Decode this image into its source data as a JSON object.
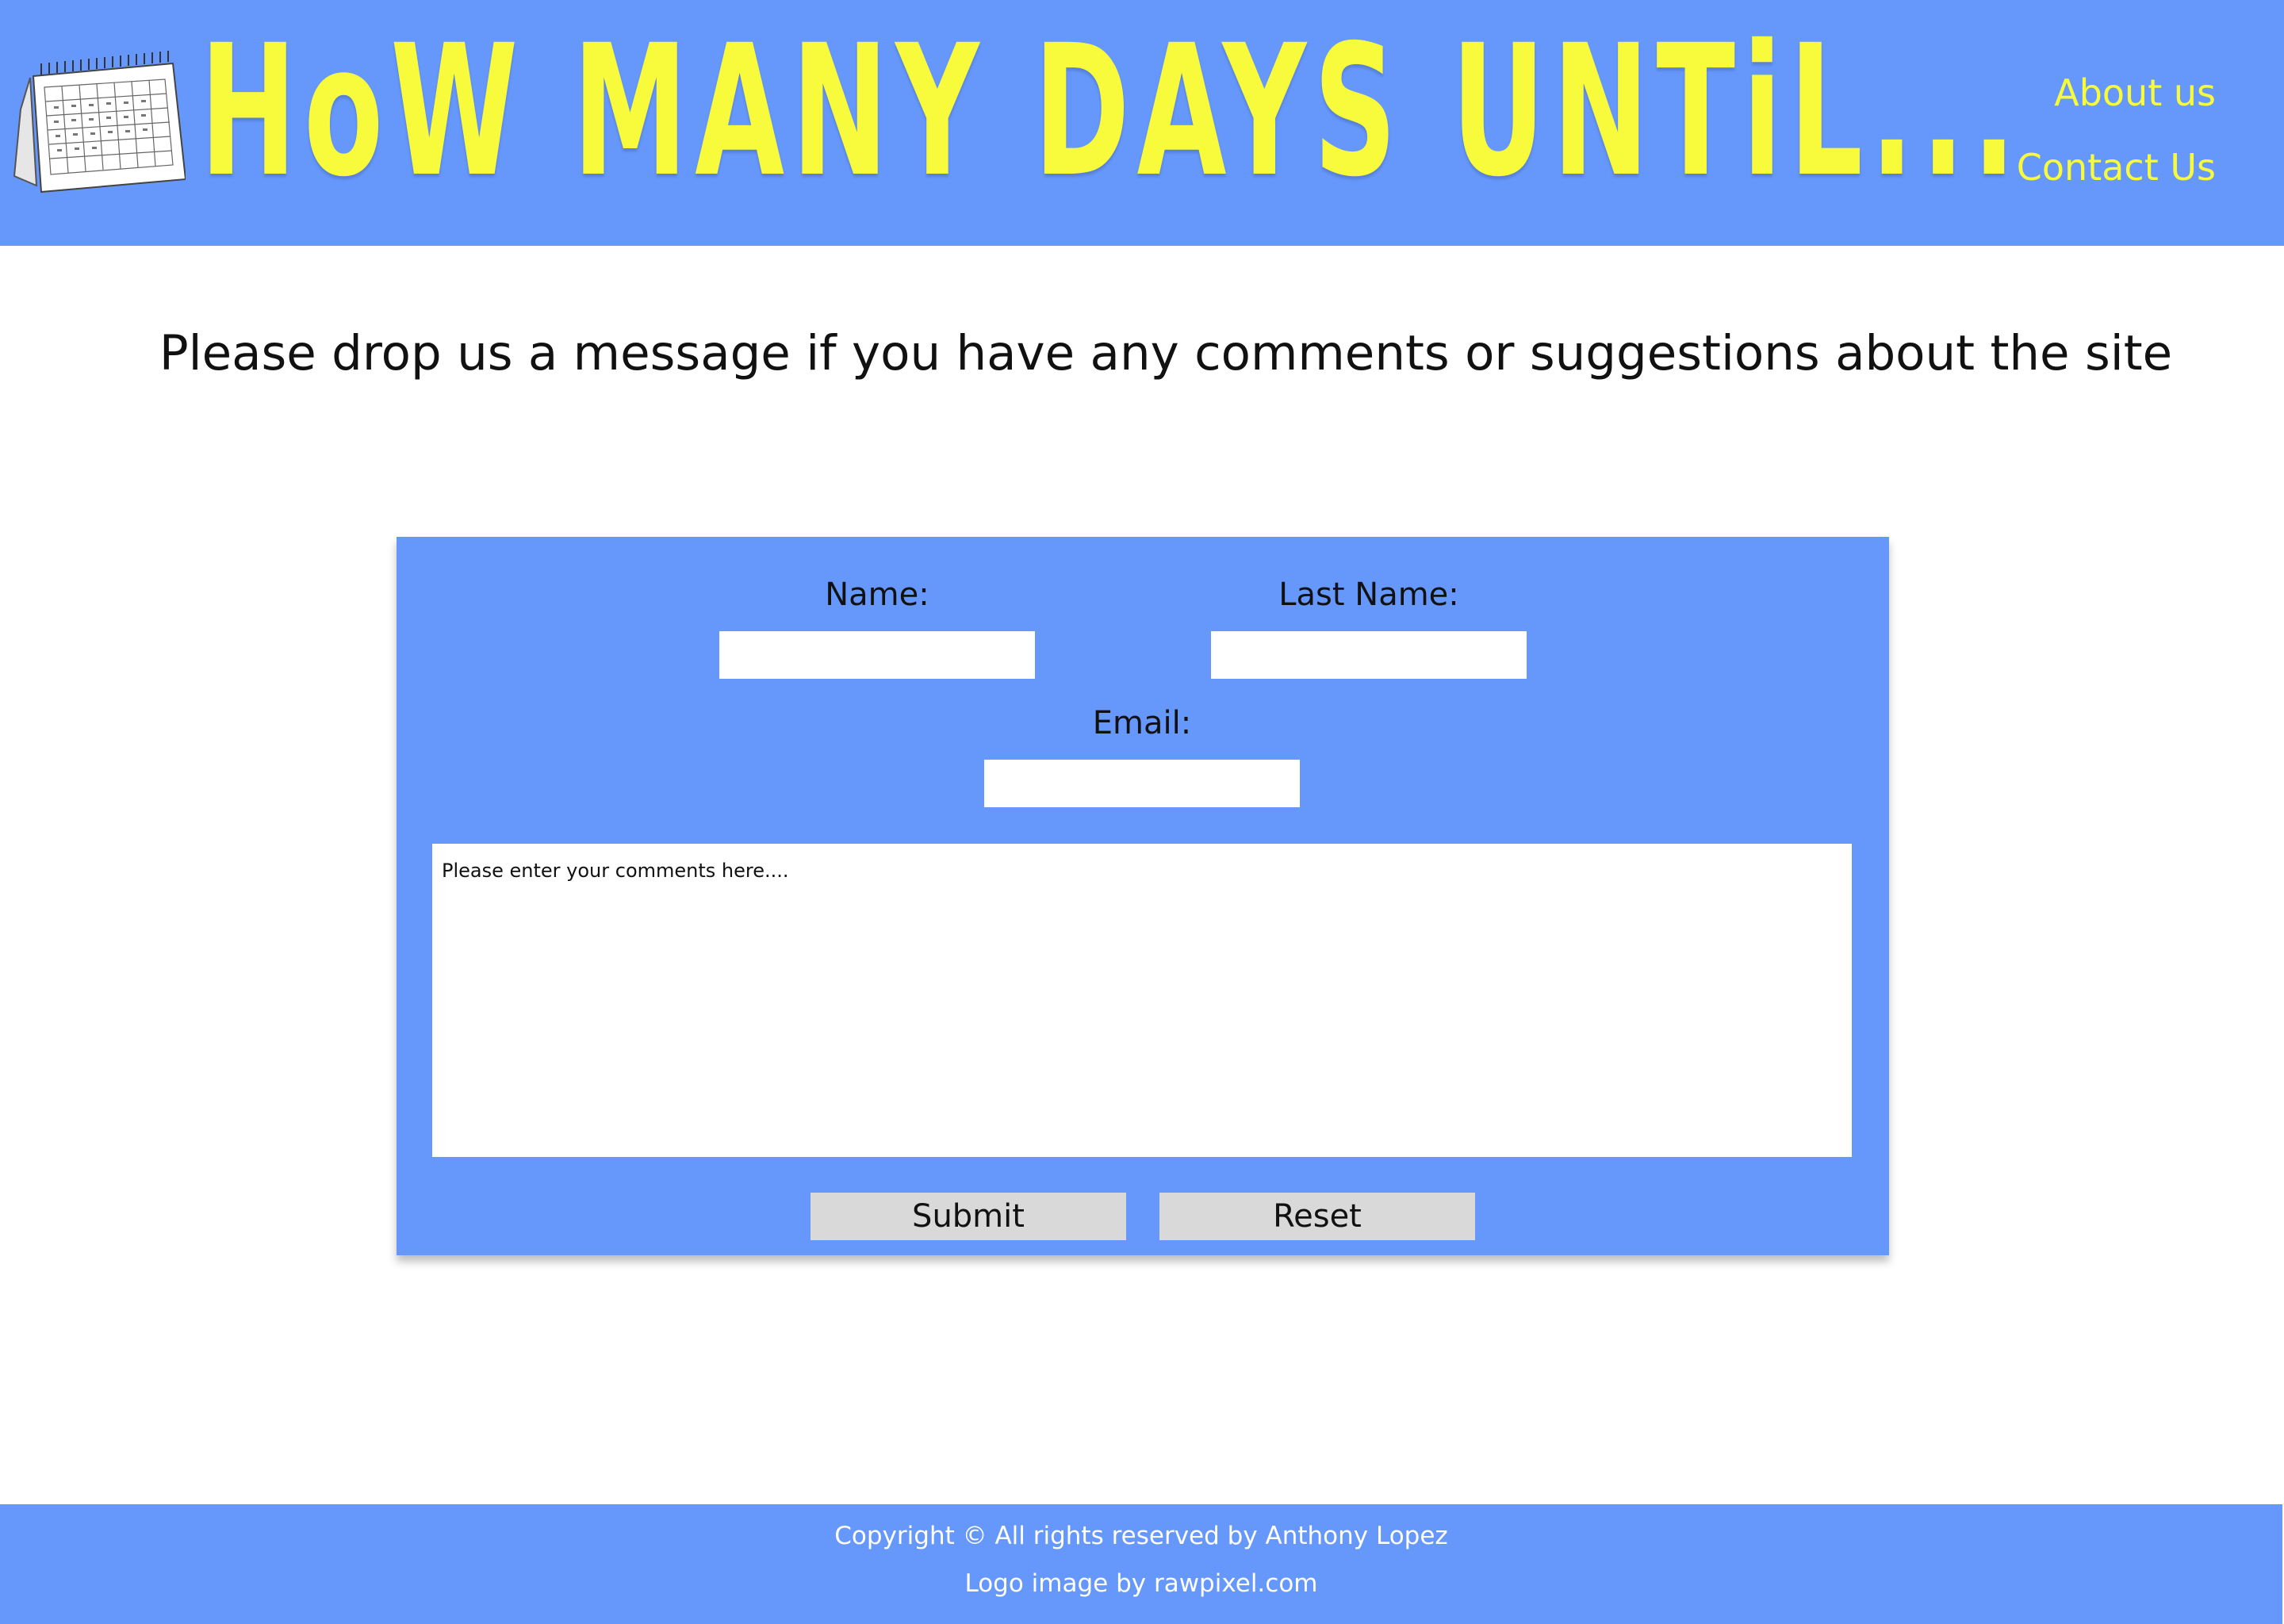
{
  "header": {
    "site_title": "HoW MANY DAYS UNTiL...",
    "nav": {
      "about_label": "About us",
      "contact_label": "Contact Us"
    },
    "logo_icon": "desk-calendar-icon"
  },
  "intro": {
    "text": "Please drop us a message if you have any comments or suggestions about the site"
  },
  "form": {
    "name_label": "Name:",
    "name_value": "",
    "last_name_label": "Last Name:",
    "last_name_value": "",
    "email_label": "Email:",
    "email_value": "",
    "comments_placeholder": "Please enter your comments here....",
    "submit_label": "Submit",
    "reset_label": "Reset"
  },
  "footer": {
    "copyright": "Copyright © All rights reserved by Anthony Lopez",
    "logo_credit": "Logo image by rawpixel.com"
  },
  "colors": {
    "primary": "#6697fb",
    "accent_yellow": "#f8fb3c",
    "button_gray": "#d9d9d9",
    "background": "#ffffff"
  }
}
